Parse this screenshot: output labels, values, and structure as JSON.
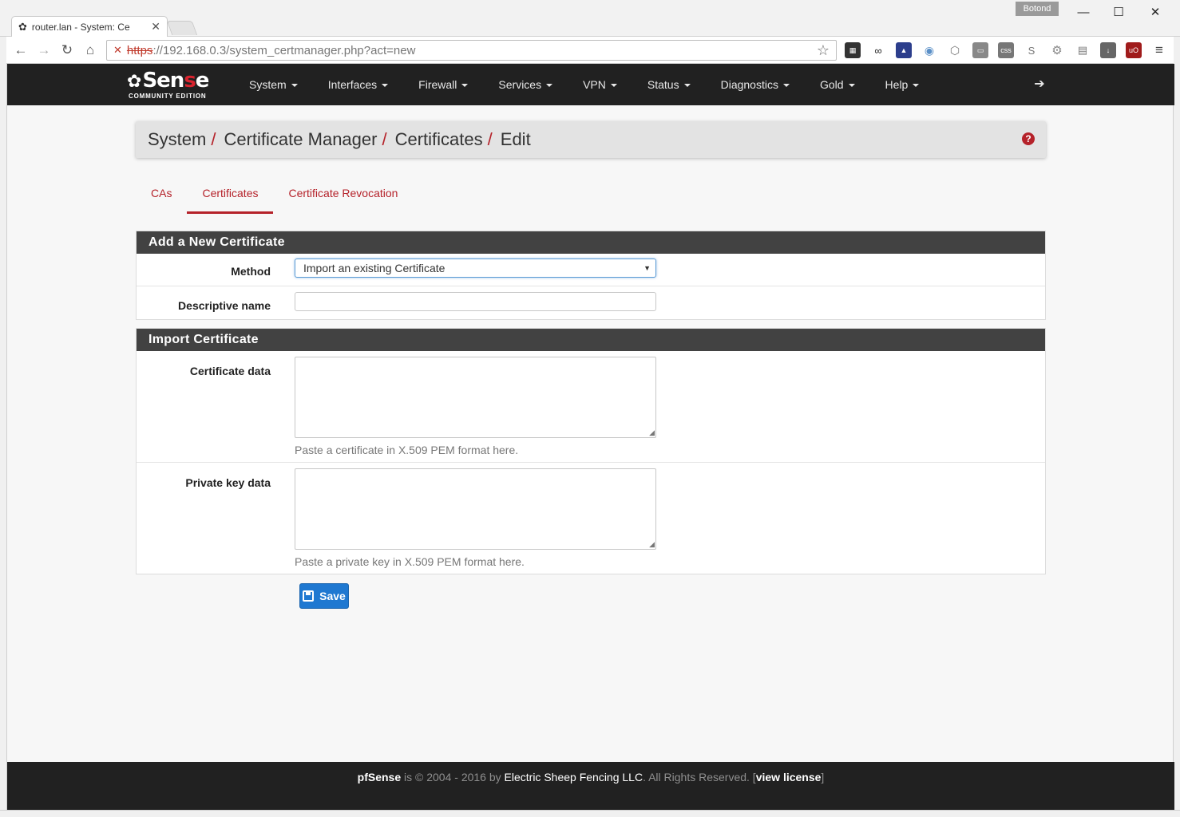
{
  "browser": {
    "tab_title": "router.lan - System: Ce",
    "tab_close": "✕",
    "profile": "Botond",
    "url_scheme": "https",
    "url_rest": "://192.168.0.3/system_certmanager.php?act=new",
    "window_controls": {
      "minimize": "—",
      "maximize": "☐",
      "close": "✕"
    }
  },
  "app": {
    "brand_prefix": "pf",
    "brand_main": "Sen",
    "brand_hl": "s",
    "brand_end": "e",
    "edition": "COMMUNITY EDITION",
    "menu": [
      "System",
      "Interfaces",
      "Firewall",
      "Services",
      "VPN",
      "Status",
      "Diagnostics",
      "Gold",
      "Help"
    ]
  },
  "breadcrumb": [
    "System",
    "Certificate Manager",
    "Certificates",
    "Edit"
  ],
  "tabs": [
    "CAs",
    "Certificates",
    "Certificate Revocation"
  ],
  "active_tab": "Certificates",
  "form": {
    "section1_title": "Add a New Certificate",
    "method_label": "Method",
    "method_value": "Import an existing Certificate",
    "descr_label": "Descriptive name",
    "descr_value": "",
    "section2_title": "Import Certificate",
    "cert_label": "Certificate data",
    "cert_hint": "Paste a certificate in X.509 PEM format here.",
    "key_label": "Private key data",
    "key_hint": "Paste a private key in X.509 PEM format here.",
    "save_label": "Save"
  },
  "footer": {
    "product": "pfSense",
    "text1": " is © 2004 - 2016 by ",
    "company": "Electric Sheep Fencing LLC",
    "text2": ". All Rights Reserved. [",
    "license": "view license",
    "text3": "]"
  },
  "colors": {
    "accent": "#b5222a",
    "nav_bg": "#212121",
    "panel_head": "#424242",
    "primary_btn": "#1f78d1"
  }
}
